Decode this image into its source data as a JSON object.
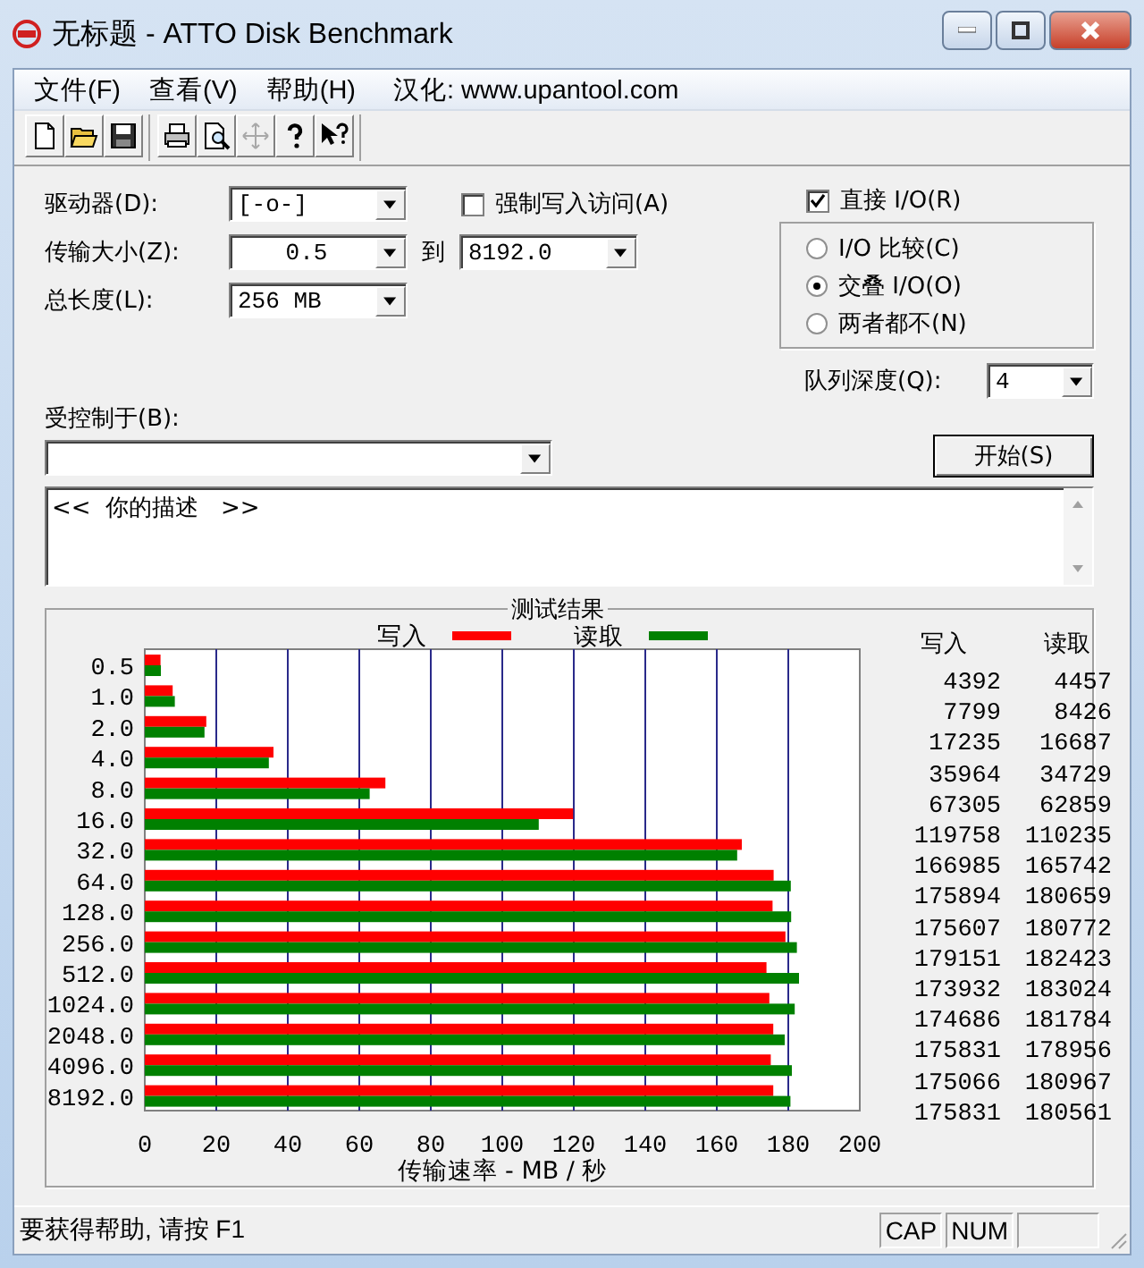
{
  "window": {
    "title": "无标题 - ATTO Disk Benchmark"
  },
  "menu": {
    "items": [
      "文件(F)",
      "查看(V)",
      "帮助(H)"
    ],
    "note": "汉化: www.upantool.com"
  },
  "toolbar": [
    {
      "kind": "new",
      "disabled": false
    },
    {
      "kind": "open",
      "disabled": false
    },
    {
      "kind": "save",
      "disabled": false
    },
    {
      "kind": "print",
      "disabled": false
    },
    {
      "kind": "preview",
      "disabled": false
    },
    {
      "kind": "move",
      "disabled": true
    },
    {
      "kind": "help",
      "disabled": false
    },
    {
      "kind": "context_help",
      "disabled": false
    }
  ],
  "drive": {
    "label": "驱动器(D):",
    "value": "[-o-]"
  },
  "force_write": {
    "label": "强制写入访问(A)",
    "checked": false
  },
  "direct_io": {
    "label": "直接 I/O(R)",
    "checked": true
  },
  "transfer_size": {
    "label": "传输大小(Z):",
    "from": "0.5",
    "to_label": "到",
    "to": "8192.0"
  },
  "total_length": {
    "label": "总长度(L):",
    "value": "256 MB"
  },
  "io_modes": [
    {
      "label": "I/O 比较(C)",
      "selected": false
    },
    {
      "label": "交叠 I/O(O)",
      "selected": true
    },
    {
      "label": "两者都不(N)",
      "selected": false
    }
  ],
  "queue_depth": {
    "label": "队列深度(Q):",
    "value": "4"
  },
  "controlled_by": {
    "label": "受控制于(B):"
  },
  "start_button": "开始(S)",
  "description": {
    "value": "<<  你的描述   >>"
  },
  "results": {
    "columns": [
      "写入",
      "读取"
    ],
    "rows": [
      {
        "write": "4392",
        "read": "4457"
      },
      {
        "write": "7799",
        "read": "8426"
      },
      {
        "write": "17235",
        "read": "16687"
      },
      {
        "write": "35964",
        "read": "34729"
      },
      {
        "write": "67305",
        "read": "62859"
      },
      {
        "write": "119758",
        "read": "110235"
      },
      {
        "write": "166985",
        "read": "165742"
      },
      {
        "write": "175894",
        "read": "180659"
      },
      {
        "write": "175607",
        "read": "180772"
      },
      {
        "write": "179151",
        "read": "182423"
      },
      {
        "write": "173932",
        "read": "183024"
      },
      {
        "write": "174686",
        "read": "181784"
      },
      {
        "write": "175831",
        "read": "178956"
      },
      {
        "write": "175066",
        "read": "180967"
      },
      {
        "write": "175831",
        "read": "180561"
      }
    ],
    "chart_data": {
      "type": "bar",
      "orientation": "horizontal",
      "title": "测试结果",
      "xlabel": "传输速率 - MB / 秒",
      "categories": [
        "0.5",
        "1.0",
        "2.0",
        "4.0",
        "8.0",
        "16.0",
        "32.0",
        "64.0",
        "128.0",
        "256.0",
        "512.0",
        "1024.0",
        "2048.0",
        "4096.0",
        "8192.0"
      ],
      "series": [
        {
          "name": "写入",
          "color": "#ff0000",
          "values": [
            4.4,
            7.8,
            17.2,
            36,
            67.3,
            119.8,
            167,
            175.9,
            175.6,
            179.2,
            173.9,
            174.7,
            175.8,
            175.1,
            175.8
          ]
        },
        {
          "name": "读取",
          "color": "#008000",
          "values": [
            4.5,
            8.4,
            16.7,
            34.7,
            62.9,
            110.2,
            165.7,
            180.7,
            180.8,
            182.4,
            183,
            181.8,
            179,
            181,
            180.6
          ]
        }
      ],
      "grid": true,
      "legend": true,
      "xlim": [
        0,
        200
      ],
      "xticks": [
        0,
        20,
        40,
        60,
        80,
        100,
        120,
        140,
        160,
        180,
        200
      ]
    }
  },
  "status_bar": {
    "text": "要获得帮助, 请按 F1",
    "indicators": [
      "CAP",
      "NUM"
    ]
  }
}
